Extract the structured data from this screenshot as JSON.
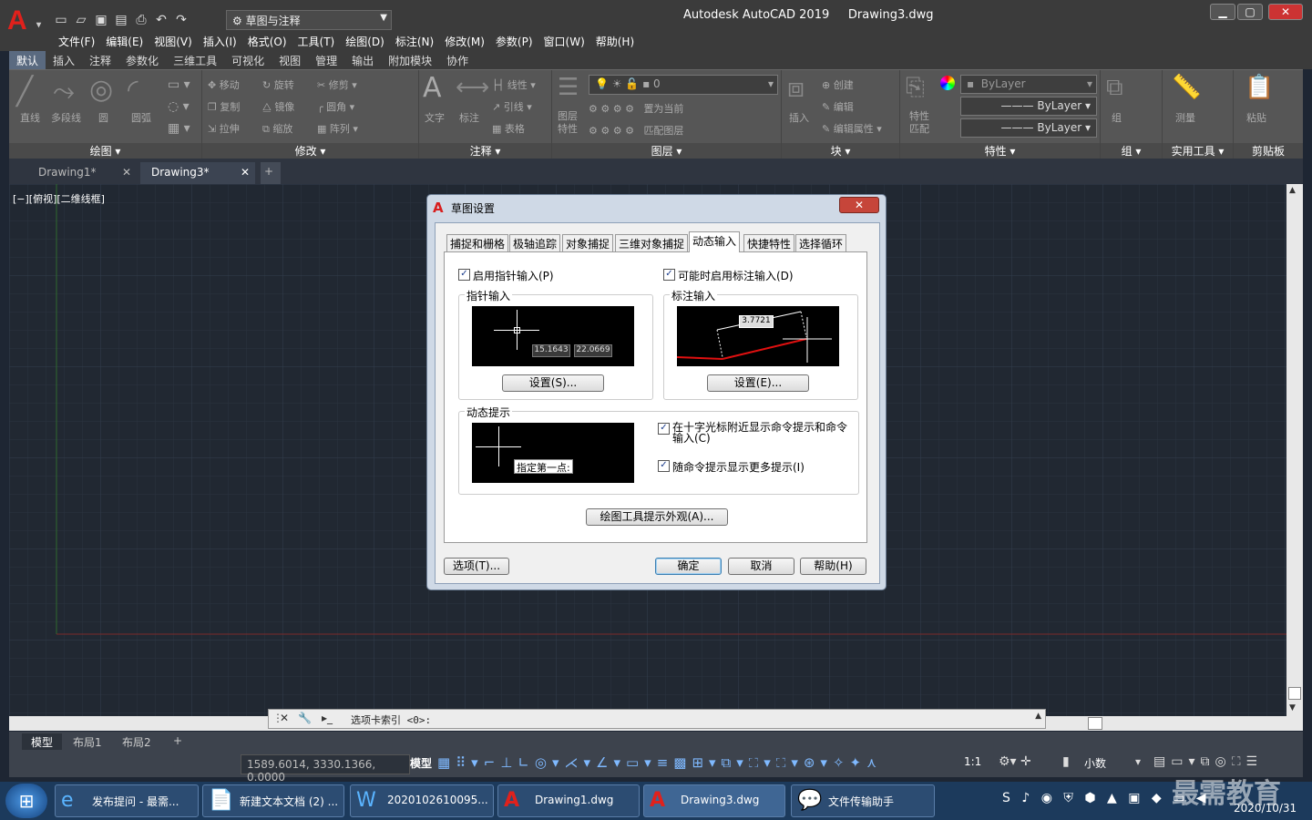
{
  "app": {
    "title": "Autodesk AutoCAD 2019",
    "file": "Drawing3.dwg",
    "logo": "A",
    "workspace": "草图与注释"
  },
  "menus": [
    "文件(F)",
    "编辑(E)",
    "视图(V)",
    "插入(I)",
    "格式(O)",
    "工具(T)",
    "绘图(D)",
    "标注(N)",
    "修改(M)",
    "参数(P)",
    "窗口(W)",
    "帮助(H)"
  ],
  "ribbon_tabs": [
    "默认",
    "插入",
    "注释",
    "参数化",
    "三维工具",
    "可视化",
    "视图",
    "管理",
    "输出",
    "附加模块",
    "协作"
  ],
  "ribbon": {
    "draw": {
      "title": "绘图",
      "line": "直线",
      "polyline": "多段线",
      "circle": "圆",
      "arc": "圆弧"
    },
    "modify": {
      "title": "修改",
      "move": "移动",
      "rotate": "旋转",
      "trim": "修剪",
      "copy": "复制",
      "mirror": "镜像",
      "fillet": "圆角",
      "stretch": "拉伸",
      "scale": "缩放",
      "array": "阵列"
    },
    "annotation": {
      "title": "注释",
      "text": "文字",
      "dimension": "标注",
      "linear": "线性",
      "leader": "引线",
      "table": "表格"
    },
    "layers": {
      "title": "图层",
      "layer_props": "图层\n特性",
      "layer_value": "0",
      "set_current": "置为当前",
      "match": "匹配图层"
    },
    "block": {
      "title": "块",
      "insert": "插入",
      "create": "创建",
      "edit": "编辑",
      "edit_attr": "编辑属性"
    },
    "properties": {
      "title": "特性",
      "match": "特性\n匹配",
      "bylayer1": "ByLayer",
      "bylayer2": "ByLayer",
      "bylayer3": "ByLayer"
    },
    "groups": {
      "title": "组",
      "group": "组"
    },
    "utilities": {
      "title": "实用工具",
      "measure": "测量"
    },
    "clipboard": {
      "title": "剪贴板",
      "paste": "粘贴"
    }
  },
  "doc_tabs": [
    "Drawing1*",
    "Drawing3*"
  ],
  "viewport_label": "[−][俯视][二维线框]",
  "dialog": {
    "title": "草图设置",
    "tabs": [
      "捕捉和栅格",
      "极轴追踪",
      "对象捕捉",
      "三维对象捕捉",
      "动态输入",
      "快捷特性",
      "选择循环"
    ],
    "enable_pointer": "启用指针输入(P)",
    "enable_dim": "可能时启用标注输入(D)",
    "pointer_group": "指针输入",
    "dim_group": "标注输入",
    "pointer_val1": "15.1643",
    "pointer_val2": "22.0669",
    "dim_val": "3.7721",
    "settings_s": "设置(S)...",
    "settings_e": "设置(E)...",
    "prompt_group": "动态提示",
    "prompt_text": "指定第一点:",
    "show_near_cursor": "在十字光标附近显示命令提示和命令输入(C)",
    "show_more": "随命令提示显示更多提示(I)",
    "tooltip_appearance": "绘图工具提示外观(A)...",
    "options": "选项(T)...",
    "ok": "确定",
    "cancel": "取消",
    "help": "帮助(H)"
  },
  "command_line": "选项卡索引 <0>:",
  "layout_tabs": [
    "模型",
    "布局1",
    "布局2"
  ],
  "status": {
    "coords": "1589.6014, 3330.1366, 0.0000",
    "model": "模型",
    "scale": "1:1",
    "units": "小数"
  },
  "taskbar": {
    "items": [
      "发布提问 - 最需...",
      "新建文本文档 (2) ...",
      "2020102610095...",
      "Drawing1.dwg",
      "Drawing3.dwg",
      "文件传输助手"
    ],
    "date": "2020/10/31",
    "watermark": "最需教育"
  },
  "colors": {
    "accent": "#e0211c",
    "canvas": "#212832",
    "ribbon": "#565656"
  }
}
